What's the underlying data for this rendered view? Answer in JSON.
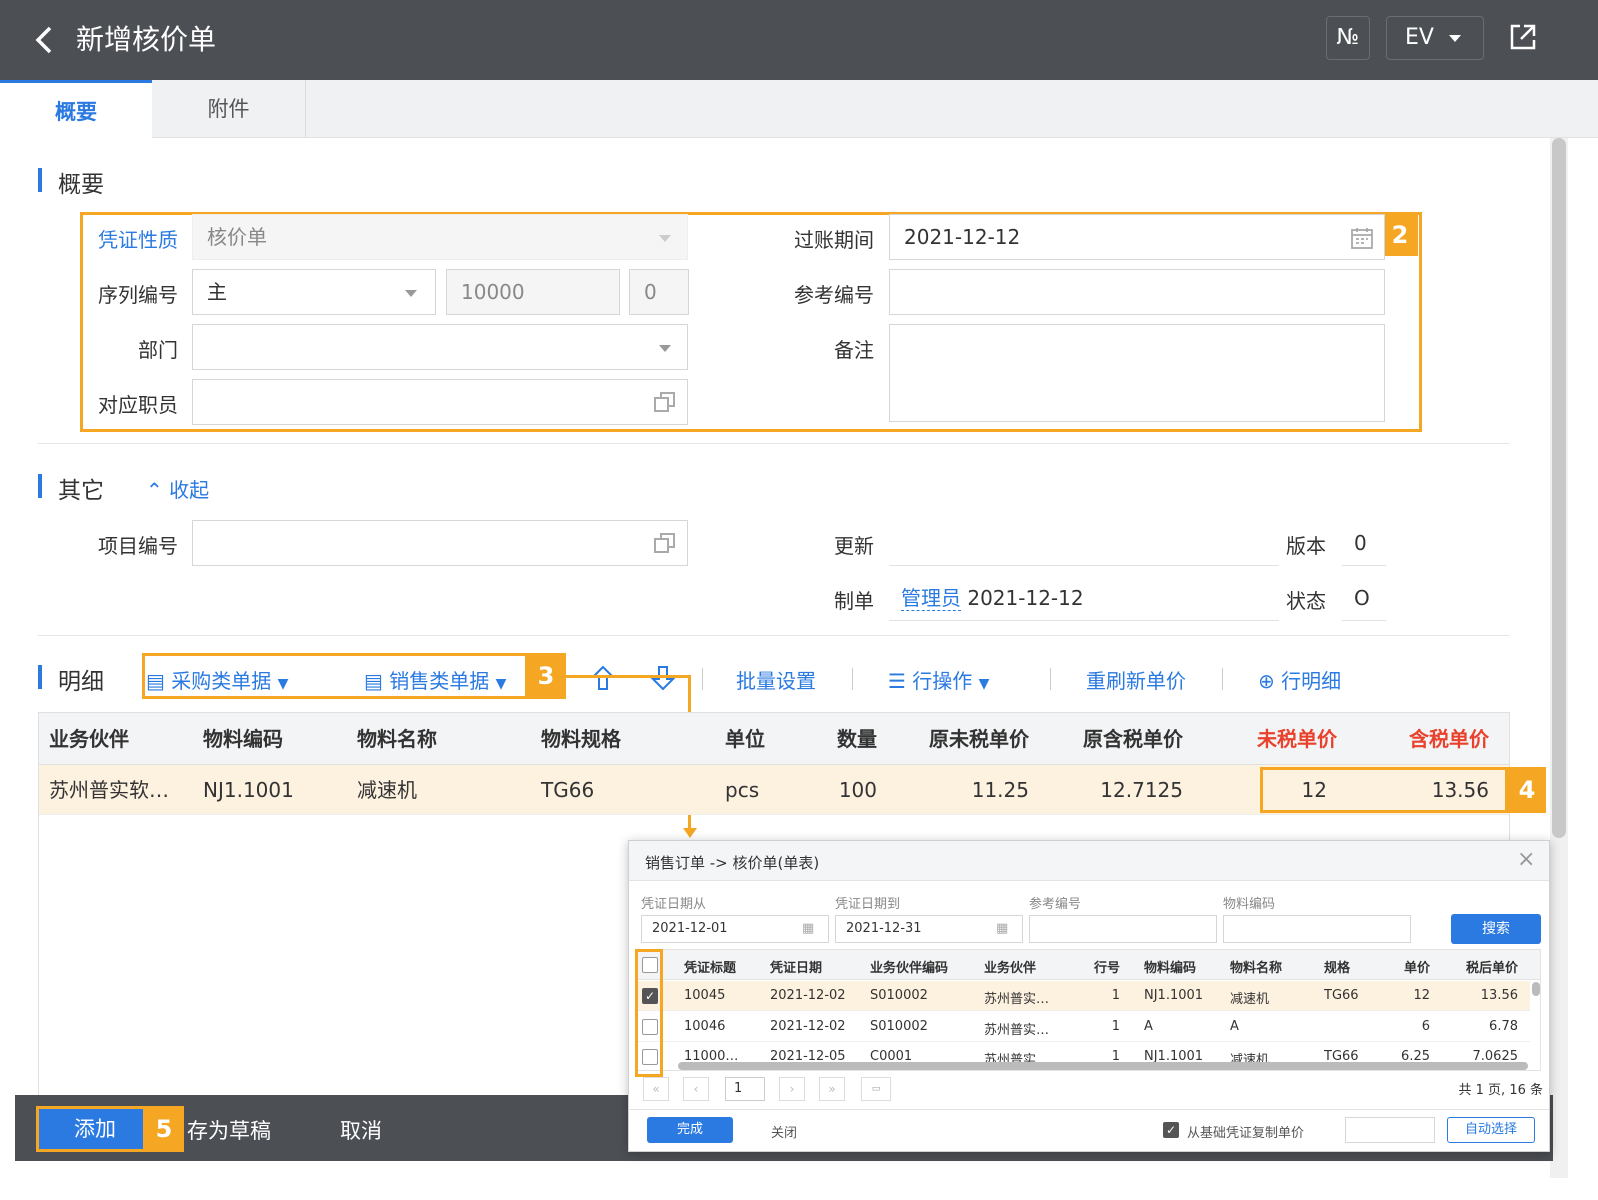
{
  "header": {
    "title": "新增核价单",
    "num_btn": "№",
    "ev_btn": "EV"
  },
  "tabs": [
    {
      "label": "概要"
    },
    {
      "label": "附件"
    }
  ],
  "summary": {
    "section_title": "概要",
    "voucher_type_label": "凭证性质",
    "voucher_type_value": "核价单",
    "serial_label": "序列编号",
    "serial_value": "主",
    "serial_number": "10000",
    "serial_suffix": "0",
    "dept_label": "部门",
    "dept_value": "",
    "employee_label": "对应职员",
    "employee_value": "",
    "posting_label": "过账期间",
    "posting_value": "2021-12-12",
    "ref_label": "参考编号",
    "ref_value": "",
    "remark_label": "备注",
    "remark_value": ""
  },
  "other": {
    "section_title": "其它",
    "collapse": "收起",
    "project_label": "项目编号",
    "project_value": "",
    "update_label": "更新",
    "update_value": "",
    "version_label": "版本",
    "version_value": "0",
    "creator_label": "制单",
    "creator_user": "管理员",
    "creator_date": "2021-12-12",
    "status_label": "状态",
    "status_value": "O"
  },
  "detail": {
    "section_title": "明细",
    "toolbar": {
      "purchase": "采购类单据",
      "sales": "销售类单据",
      "batch": "批量设置",
      "row_ops": "行操作",
      "refresh": "重刷新单价",
      "row_detail": "行明细"
    },
    "columns": [
      "业务伙伴",
      "物料编码",
      "物料名称",
      "物料规格",
      "单位",
      "数量",
      "原未税单价",
      "原含税单价",
      "未税单价",
      "含税单价"
    ],
    "rows": [
      [
        "苏州普实软…",
        "NJ1.1001",
        "减速机",
        "TG66",
        "pcs",
        "100",
        "11.25",
        "12.7125",
        "12",
        "13.56"
      ]
    ]
  },
  "dialog": {
    "title": "销售订单 -> 核价单(单表)",
    "filters": [
      {
        "label": "凭证日期从",
        "value": "2021-12-01"
      },
      {
        "label": "凭证日期到",
        "value": "2021-12-31"
      },
      {
        "label": "参考编号",
        "value": ""
      },
      {
        "label": "物料编码",
        "value": ""
      }
    ],
    "search": "搜索",
    "columns": [
      "凭证标题",
      "凭证日期",
      "业务伙伴编码",
      "业务伙伴",
      "行号",
      "物料编码",
      "物料名称",
      "规格",
      "单价",
      "税后单价"
    ],
    "rows": [
      {
        "checked": true,
        "cells": [
          "10045",
          "2021-12-02",
          "S010002",
          "苏州普实…",
          "1",
          "NJ1.1001",
          "减速机",
          "TG66",
          "12",
          "13.56"
        ]
      },
      {
        "checked": false,
        "cells": [
          "10046",
          "2021-12-02",
          "S010002",
          "苏州普实…",
          "1",
          "A",
          "A",
          "",
          "6",
          "6.78"
        ]
      },
      {
        "checked": false,
        "cells": [
          "11000…",
          "2021-12-05",
          "C0001",
          "苏州普实",
          "1",
          "NJ1.1001",
          "减速机",
          "TG66",
          "6.25",
          "7.0625"
        ]
      }
    ],
    "page": "1",
    "page_info": "共 1 页, 16 条",
    "done": "完成",
    "close": "关闭",
    "copy_price": "从基础凭证复制单价",
    "auto_select": "自动选择"
  },
  "footer": {
    "add": "添加",
    "draft": "存为草稿",
    "cancel": "取消"
  },
  "badges": [
    "2",
    "3",
    "4",
    "5"
  ],
  "colors": {
    "accent": "#2a7ae2",
    "highlight": "#f5a623",
    "topbar": "#4c4f54",
    "red": "#e8412c"
  }
}
